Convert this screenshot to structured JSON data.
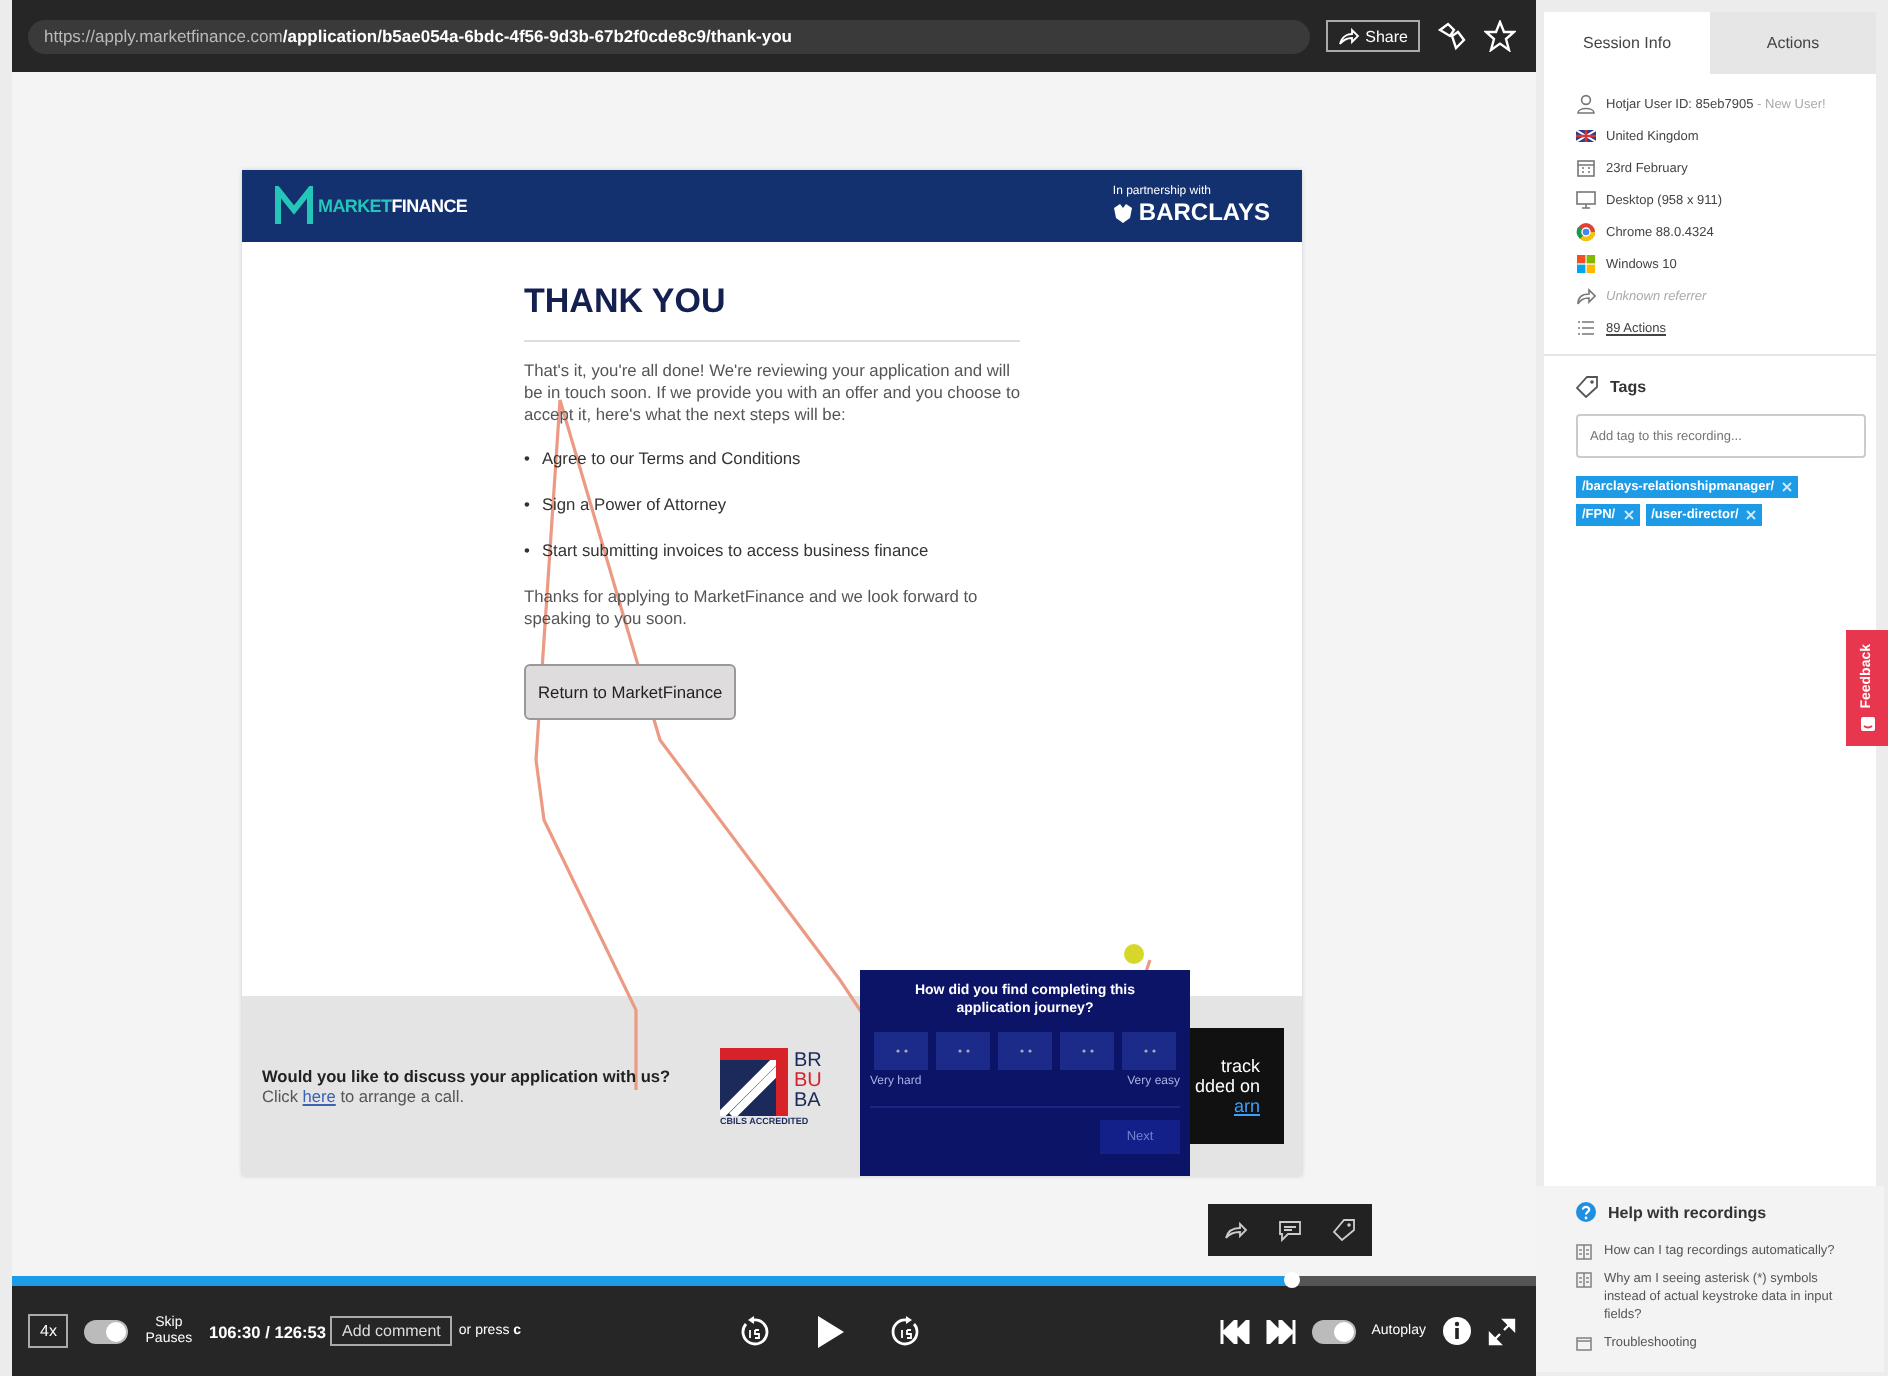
{
  "address_bar": {
    "url_base": "https://apply.marketfinance.com",
    "url_path": "/application/b5ae054a-6bdc-4f56-9d3b-67b2f0cde8c9/thank-you",
    "share_label": "Share"
  },
  "page": {
    "logo_text_a": "MARKET",
    "logo_text_b": "FINANCE",
    "partner_caption": "In partnership with",
    "partner_name": "BARCLAYS",
    "title": "THANK YOU",
    "intro": "That's it, you're all done! We're reviewing your application and will be in touch soon. If we provide you with an offer and you choose to accept it, here's what the next steps will be:",
    "step_marker": "•",
    "steps": [
      "Agree to our Terms and Conditions",
      "Sign a Power of Attorney",
      "Start submitting invoices to access business finance"
    ],
    "closing": "Thanks for applying to MarketFinance and we look forward to speaking to you soon.",
    "return_button": "Return to MarketFinance",
    "footer_question": "Would you like to discuss your application with us?",
    "footer_prefix": "Click ",
    "footer_link": "here",
    "footer_suffix": " to arrange a call.",
    "bank_fragments": [
      "BR",
      "BU",
      "BA"
    ],
    "bank_caption": "CBILS ACCREDITED",
    "dark_box_lines": [
      "track",
      "dded on"
    ],
    "dark_box_link": "arn"
  },
  "survey": {
    "question": "How did you find completing this application journey?",
    "ratings": [
      {
        "selected": false
      },
      {
        "selected": false
      },
      {
        "selected": false
      },
      {
        "selected": false
      },
      {
        "selected": false
      }
    ],
    "low_label": "Very hard",
    "high_label": "Very easy",
    "next_label": "Next",
    "next_disabled": true
  },
  "player": {
    "speed": "4x",
    "skip_pauses": {
      "label": "Skip Pauses",
      "on": true
    },
    "time": "106:30 / 126:53",
    "comment_button": "Add comment",
    "comment_hint": "or press **c**",
    "autoplay": {
      "label": "Autoplay",
      "on": true
    },
    "progress": {
      "level": 0.84
    }
  },
  "sidebar": {
    "tabs": [
      {
        "label": "Session Info",
        "selected": true
      },
      {
        "label": "Actions",
        "selected": false
      }
    ],
    "info": [
      {
        "kind": "user",
        "text": "Hotjar User ID: 85eb7905",
        "note": " - New User!"
      },
      {
        "kind": "flag",
        "text": "United Kingdom"
      },
      {
        "kind": "calendar",
        "text": "23rd February"
      },
      {
        "kind": "desktop",
        "text": "Desktop (958 x 911)"
      },
      {
        "kind": "browser",
        "text": "Chrome 88.0.4324"
      },
      {
        "kind": "windows",
        "text": "Windows 10"
      },
      {
        "kind": "referrer",
        "text": "Unknown referrer",
        "muted": true
      },
      {
        "kind": "actions",
        "text": "89 Actions",
        "link": true
      }
    ],
    "tags_title": "Tags",
    "tag_placeholder": "Add tag to this recording...",
    "tags": [
      "/barclays-relationshipmanager/",
      "/FPN/",
      "/user-director/"
    ],
    "help_title": "Help with recordings",
    "help_items": [
      {
        "kind": "article",
        "text": "How can I tag recordings automatically?"
      },
      {
        "kind": "article",
        "text": "Why am I seeing asterisk (*) symbols instead of actual keystroke data in input fields?"
      },
      {
        "kind": "section",
        "text": "Troubleshooting"
      }
    ]
  },
  "feedback_tab": "Feedback"
}
